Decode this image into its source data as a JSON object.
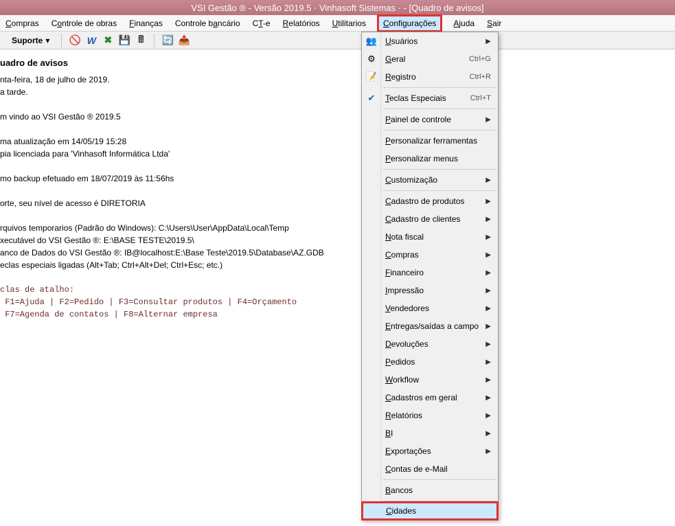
{
  "title": "VSI Gestão ® - Versão 2019.5 · Vinhasoft Sistemas ·  - [Quadro de avisos]",
  "menubar": {
    "compras": "Compras",
    "controle_obras": "Controle de obras",
    "financas": "Finanças",
    "controle_bancario": "Controle bancário",
    "cte": "CT-e",
    "relatorios": "Relatórios",
    "utilitarios": "Utilitarios",
    "configuracoes": "Configurações",
    "ajuda": "Ajuda",
    "sair": "Sair"
  },
  "toolbar": {
    "suporte": "Suporte"
  },
  "content": {
    "heading": "uadro de avisos",
    "line1": "nta-feira, 18 de julho de 2019.",
    "line2": "a tarde.",
    "line3": "m vindo ao VSI Gestão ® 2019.5",
    "line4": "ma atualização em 14/05/19 15:28",
    "line5": "pia licenciada para 'Vinhasoft Informática Ltda'",
    "line6": "mo backup efetuado em 18/07/2019 às 11:56hs",
    "line7": "orte, seu nível de acesso é DIRETORIA",
    "line8": "rquivos temporarios (Padrão do Windows): C:\\Users\\User\\AppData\\Local\\Temp",
    "line9": "xecutável do VSI Gestão ®: E:\\BASE TESTE\\2019.5\\",
    "line10": "anco de Dados do VSI Gestão ®: IB@localhost:E:\\Base Teste\\2019.5\\Database\\AZ.GDB",
    "line11": "eclas especiais ligadas (Alt+Tab; Ctrl+Alt+Del; Ctrl+Esc; etc.)",
    "mono1": "clas de atalho:",
    "mono2": " F1=Ajuda | F2=Pedido | F3=Consultar produtos | F4=Orçamento",
    "mono3": " F7=Agenda de contatos | F8=Alternar empresa"
  },
  "dropdown": [
    {
      "label": "Usuários",
      "arrow": true,
      "icon": "users"
    },
    {
      "label": "Geral",
      "shortcut": "Ctrl+G",
      "icon": "gear"
    },
    {
      "label": "Registro",
      "shortcut": "Ctrl+R",
      "icon": "registry"
    },
    {
      "sep": true
    },
    {
      "label": "Teclas Especiais",
      "shortcut": "Ctrl+T",
      "icon": "check"
    },
    {
      "sep": true
    },
    {
      "label": "Painel de controle",
      "arrow": true
    },
    {
      "sep": true
    },
    {
      "label": "Personalizar ferramentas"
    },
    {
      "label": "Personalizar menus"
    },
    {
      "sep": true
    },
    {
      "label": "Customização",
      "arrow": true
    },
    {
      "sep": true
    },
    {
      "label": "Cadastro de produtos",
      "arrow": true
    },
    {
      "label": "Cadastro de clientes",
      "arrow": true
    },
    {
      "label": "Nota fiscal",
      "arrow": true
    },
    {
      "label": "Compras",
      "arrow": true
    },
    {
      "label": "Financeiro",
      "arrow": true
    },
    {
      "label": "Impressão",
      "arrow": true
    },
    {
      "label": "Vendedores",
      "arrow": true
    },
    {
      "label": "Entregas/saídas a campo",
      "arrow": true
    },
    {
      "label": "Devoluções",
      "arrow": true
    },
    {
      "label": "Pedidos",
      "arrow": true
    },
    {
      "label": "Workflow",
      "arrow": true
    },
    {
      "label": "Cadastros em geral",
      "arrow": true
    },
    {
      "label": "Relatórios",
      "arrow": true
    },
    {
      "label": "BI",
      "arrow": true
    },
    {
      "label": "Exportações",
      "arrow": true
    },
    {
      "label": "Contas de e-Mail"
    },
    {
      "sep": true
    },
    {
      "label": "Bancos"
    },
    {
      "sep": true
    },
    {
      "label": "Cidades",
      "highlight": true,
      "redbox": true
    }
  ]
}
